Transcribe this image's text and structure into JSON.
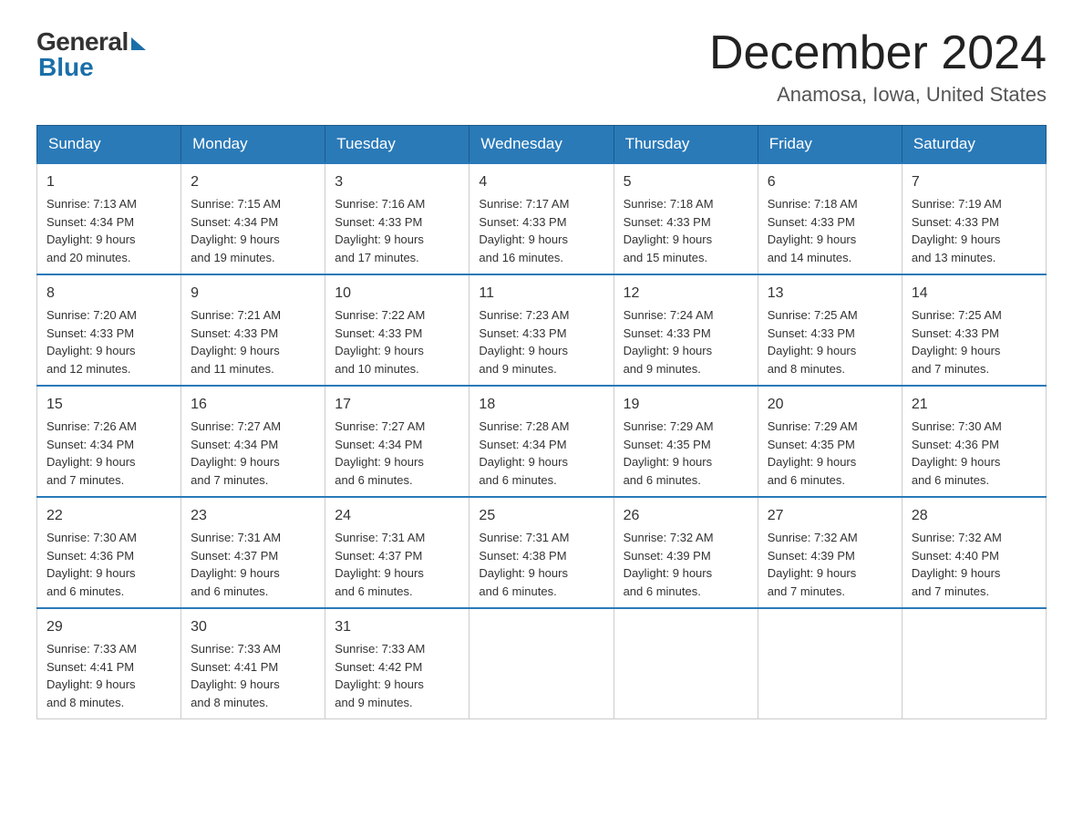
{
  "header": {
    "logo_general": "General",
    "logo_blue": "Blue",
    "month_title": "December 2024",
    "location": "Anamosa, Iowa, United States"
  },
  "days_of_week": [
    "Sunday",
    "Monday",
    "Tuesday",
    "Wednesday",
    "Thursday",
    "Friday",
    "Saturday"
  ],
  "weeks": [
    [
      {
        "day": "1",
        "sunrise": "7:13 AM",
        "sunset": "4:34 PM",
        "daylight": "9 hours and 20 minutes."
      },
      {
        "day": "2",
        "sunrise": "7:15 AM",
        "sunset": "4:34 PM",
        "daylight": "9 hours and 19 minutes."
      },
      {
        "day": "3",
        "sunrise": "7:16 AM",
        "sunset": "4:33 PM",
        "daylight": "9 hours and 17 minutes."
      },
      {
        "day": "4",
        "sunrise": "7:17 AM",
        "sunset": "4:33 PM",
        "daylight": "9 hours and 16 minutes."
      },
      {
        "day": "5",
        "sunrise": "7:18 AM",
        "sunset": "4:33 PM",
        "daylight": "9 hours and 15 minutes."
      },
      {
        "day": "6",
        "sunrise": "7:18 AM",
        "sunset": "4:33 PM",
        "daylight": "9 hours and 14 minutes."
      },
      {
        "day": "7",
        "sunrise": "7:19 AM",
        "sunset": "4:33 PM",
        "daylight": "9 hours and 13 minutes."
      }
    ],
    [
      {
        "day": "8",
        "sunrise": "7:20 AM",
        "sunset": "4:33 PM",
        "daylight": "9 hours and 12 minutes."
      },
      {
        "day": "9",
        "sunrise": "7:21 AM",
        "sunset": "4:33 PM",
        "daylight": "9 hours and 11 minutes."
      },
      {
        "day": "10",
        "sunrise": "7:22 AM",
        "sunset": "4:33 PM",
        "daylight": "9 hours and 10 minutes."
      },
      {
        "day": "11",
        "sunrise": "7:23 AM",
        "sunset": "4:33 PM",
        "daylight": "9 hours and 9 minutes."
      },
      {
        "day": "12",
        "sunrise": "7:24 AM",
        "sunset": "4:33 PM",
        "daylight": "9 hours and 9 minutes."
      },
      {
        "day": "13",
        "sunrise": "7:25 AM",
        "sunset": "4:33 PM",
        "daylight": "9 hours and 8 minutes."
      },
      {
        "day": "14",
        "sunrise": "7:25 AM",
        "sunset": "4:33 PM",
        "daylight": "9 hours and 7 minutes."
      }
    ],
    [
      {
        "day": "15",
        "sunrise": "7:26 AM",
        "sunset": "4:34 PM",
        "daylight": "9 hours and 7 minutes."
      },
      {
        "day": "16",
        "sunrise": "7:27 AM",
        "sunset": "4:34 PM",
        "daylight": "9 hours and 7 minutes."
      },
      {
        "day": "17",
        "sunrise": "7:27 AM",
        "sunset": "4:34 PM",
        "daylight": "9 hours and 6 minutes."
      },
      {
        "day": "18",
        "sunrise": "7:28 AM",
        "sunset": "4:34 PM",
        "daylight": "9 hours and 6 minutes."
      },
      {
        "day": "19",
        "sunrise": "7:29 AM",
        "sunset": "4:35 PM",
        "daylight": "9 hours and 6 minutes."
      },
      {
        "day": "20",
        "sunrise": "7:29 AM",
        "sunset": "4:35 PM",
        "daylight": "9 hours and 6 minutes."
      },
      {
        "day": "21",
        "sunrise": "7:30 AM",
        "sunset": "4:36 PM",
        "daylight": "9 hours and 6 minutes."
      }
    ],
    [
      {
        "day": "22",
        "sunrise": "7:30 AM",
        "sunset": "4:36 PM",
        "daylight": "9 hours and 6 minutes."
      },
      {
        "day": "23",
        "sunrise": "7:31 AM",
        "sunset": "4:37 PM",
        "daylight": "9 hours and 6 minutes."
      },
      {
        "day": "24",
        "sunrise": "7:31 AM",
        "sunset": "4:37 PM",
        "daylight": "9 hours and 6 minutes."
      },
      {
        "day": "25",
        "sunrise": "7:31 AM",
        "sunset": "4:38 PM",
        "daylight": "9 hours and 6 minutes."
      },
      {
        "day": "26",
        "sunrise": "7:32 AM",
        "sunset": "4:39 PM",
        "daylight": "9 hours and 6 minutes."
      },
      {
        "day": "27",
        "sunrise": "7:32 AM",
        "sunset": "4:39 PM",
        "daylight": "9 hours and 7 minutes."
      },
      {
        "day": "28",
        "sunrise": "7:32 AM",
        "sunset": "4:40 PM",
        "daylight": "9 hours and 7 minutes."
      }
    ],
    [
      {
        "day": "29",
        "sunrise": "7:33 AM",
        "sunset": "4:41 PM",
        "daylight": "9 hours and 8 minutes."
      },
      {
        "day": "30",
        "sunrise": "7:33 AM",
        "sunset": "4:41 PM",
        "daylight": "9 hours and 8 minutes."
      },
      {
        "day": "31",
        "sunrise": "7:33 AM",
        "sunset": "4:42 PM",
        "daylight": "9 hours and 9 minutes."
      },
      null,
      null,
      null,
      null
    ]
  ],
  "labels": {
    "sunrise": "Sunrise:",
    "sunset": "Sunset:",
    "daylight": "Daylight:"
  }
}
